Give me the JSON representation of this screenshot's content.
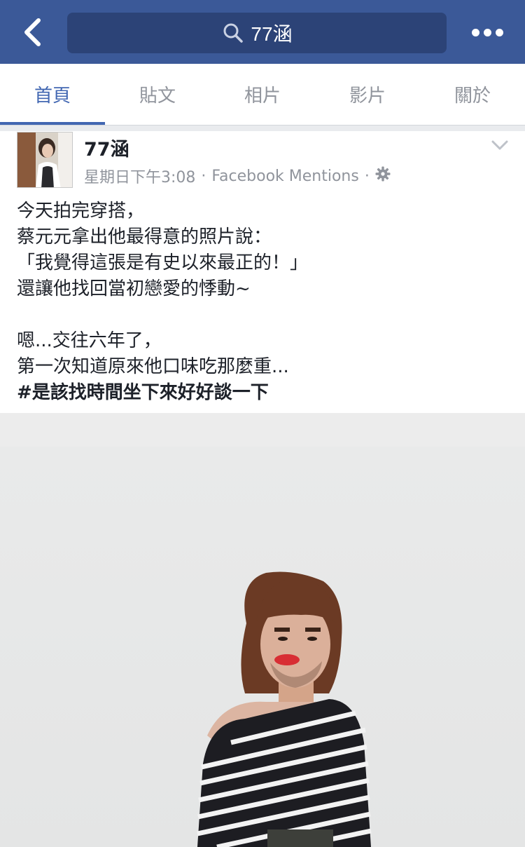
{
  "nav": {
    "search_text": "77涵"
  },
  "tabs": [
    {
      "label": "首頁",
      "active": true
    },
    {
      "label": "貼文",
      "active": false
    },
    {
      "label": "相片",
      "active": false
    },
    {
      "label": "影片",
      "active": false
    },
    {
      "label": "關於",
      "active": false
    }
  ],
  "post": {
    "author": "77涵",
    "time": "星期日下午3:08",
    "separator": "·",
    "source": "Facebook Mentions",
    "lines": [
      "今天拍完穿搭，",
      "蔡元元拿出他最得意的照片說：",
      "「我覺得這張是有史以來最正的！」",
      "還讓他找回當初戀愛的悸動~",
      "",
      "嗯...交往六年了，",
      "第一次知道原來他口味吃那麼重..."
    ],
    "hashtag": "#是該找時間坐下來好好談一下"
  },
  "icons": {
    "back": "back-chevron-icon",
    "search": "search-icon",
    "more": "more-dots-icon",
    "chevron": "chevron-down-icon",
    "privacy": "gear-icon"
  },
  "colors": {
    "brand": "#3b5998",
    "search_bg": "#2c4377",
    "active_tab": "#4267b2",
    "muted": "#90949c"
  }
}
